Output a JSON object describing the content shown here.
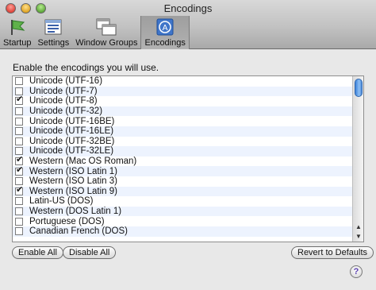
{
  "window": {
    "title": "Encodings"
  },
  "toolbar": {
    "items": [
      {
        "label": "Startup",
        "icon": "flag-icon",
        "active": false
      },
      {
        "label": "Settings",
        "icon": "settings-icon",
        "active": false
      },
      {
        "label": "Window Groups",
        "icon": "window-groups-icon",
        "active": false
      },
      {
        "label": "Encodings",
        "icon": "encodings-icon",
        "active": true
      }
    ]
  },
  "main": {
    "prompt": "Enable the encodings you will use.",
    "encodings": [
      {
        "label": "Unicode (UTF-16)",
        "checked": false
      },
      {
        "label": "Unicode (UTF-7)",
        "checked": false
      },
      {
        "label": "Unicode (UTF-8)",
        "checked": true
      },
      {
        "label": "Unicode (UTF-32)",
        "checked": false
      },
      {
        "label": "Unicode (UTF-16BE)",
        "checked": false
      },
      {
        "label": "Unicode (UTF-16LE)",
        "checked": false
      },
      {
        "label": "Unicode (UTF-32BE)",
        "checked": false
      },
      {
        "label": "Unicode (UTF-32LE)",
        "checked": false
      },
      {
        "label": "Western (Mac OS Roman)",
        "checked": true
      },
      {
        "label": "Western (ISO Latin 1)",
        "checked": true
      },
      {
        "label": "Western (ISO Latin 3)",
        "checked": false
      },
      {
        "label": "Western (ISO Latin 9)",
        "checked": true
      },
      {
        "label": "Latin-US (DOS)",
        "checked": false
      },
      {
        "label": "Western (DOS Latin 1)",
        "checked": false
      },
      {
        "label": "Portuguese (DOS)",
        "checked": false
      },
      {
        "label": "Canadian French (DOS)",
        "checked": false
      }
    ]
  },
  "buttons": {
    "enable_all": "Enable All",
    "disable_all": "Disable All",
    "revert": "Revert to Defaults",
    "help": "?"
  },
  "colors": {
    "alt_row": "#edf3fe",
    "scroll_thumb": "#3d82d9"
  }
}
